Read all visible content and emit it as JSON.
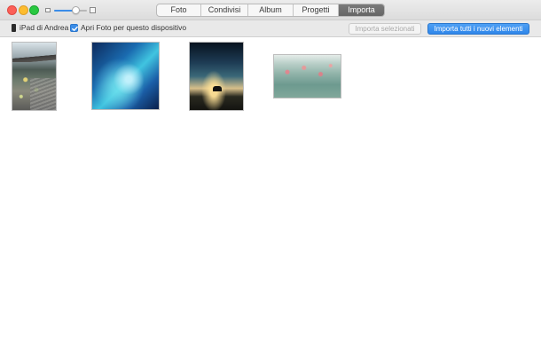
{
  "window": {
    "controls": {
      "close": "close-button",
      "minimize": "minimize-button",
      "zoom": "fullscreen-button"
    }
  },
  "toolbar": {
    "zoom_slider": {
      "value": 0.65,
      "small_icon": "small-thumbnails-icon",
      "large_icon": "large-thumbnails-icon"
    },
    "tabs": [
      {
        "label": "Foto",
        "active": false
      },
      {
        "label": "Condivisi",
        "active": false
      },
      {
        "label": "Album",
        "active": false
      },
      {
        "label": "Progetti",
        "active": false
      },
      {
        "label": "Importa",
        "active": true
      }
    ]
  },
  "import_bar": {
    "device_icon": "ipad-icon",
    "device_name": "iPad di Andrea",
    "open_photos_checkbox": {
      "checked": true,
      "label": "Apri Foto per questo dispositivo"
    },
    "import_selected_label": "Importa selezionati",
    "import_all_label": "Importa tutti i nuovi elementi"
  },
  "photos": [
    {
      "description": "temple"
    },
    {
      "description": "milky-way"
    },
    {
      "description": "night-sky"
    },
    {
      "description": "flowers"
    }
  ],
  "colors": {
    "accent": "#3b8de8",
    "active_tab": "#6e6e6e",
    "toolbar_bg": "#e4e4e4",
    "importbar_bg": "#e9e9e9"
  }
}
